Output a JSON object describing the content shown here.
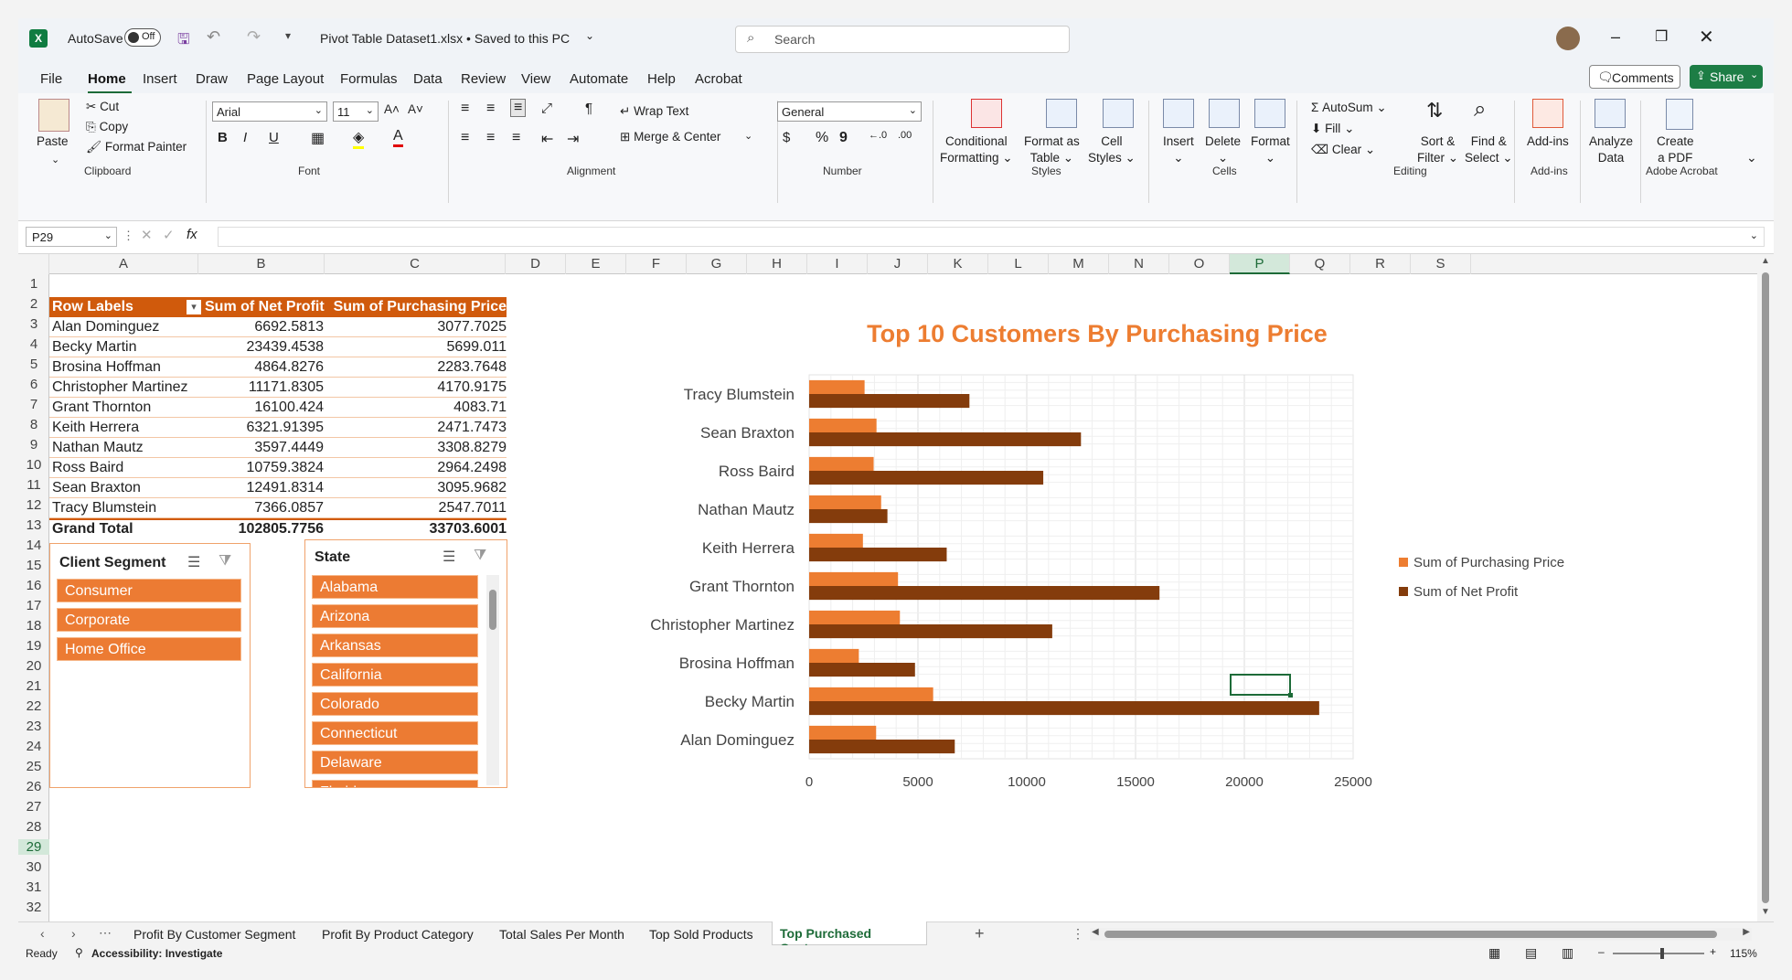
{
  "window": {
    "autosave_label": "AutoSave",
    "autosave_state": "Off",
    "file_title": "Pivot Table Dataset1.xlsx • Saved to this PC",
    "search_placeholder": "Search"
  },
  "menu": {
    "tabs": [
      "File",
      "Home",
      "Insert",
      "Draw",
      "Page Layout",
      "Formulas",
      "Data",
      "Review",
      "View",
      "Automate",
      "Help",
      "Acrobat"
    ],
    "active": "Home",
    "comments": "Comments",
    "share": "Share"
  },
  "ribbon": {
    "clipboard": {
      "paste": "Paste",
      "cut": "Cut",
      "copy": "Copy",
      "format_painter": "Format Painter",
      "label": "Clipboard"
    },
    "font": {
      "name": "Arial",
      "size": "11",
      "bold": "B",
      "italic": "I",
      "underline": "U",
      "label": "Font"
    },
    "alignment": {
      "wrap": "Wrap Text",
      "merge": "Merge & Center",
      "label": "Alignment"
    },
    "number": {
      "format": "General",
      "currency": "$",
      "percent": "%",
      "comma": "9",
      "label": "Number"
    },
    "styles": {
      "conditional": "Conditional",
      "conditional2": "Formatting",
      "format_as": "Format as",
      "format_as2": "Table",
      "cell": "Cell",
      "cell2": "Styles",
      "label": "Styles"
    },
    "cells": {
      "insert": "Insert",
      "delete": "Delete",
      "format": "Format",
      "label": "Cells"
    },
    "editing": {
      "autosum": "AutoSum",
      "fill": "Fill",
      "clear": "Clear",
      "sort": "Sort &",
      "sort2": "Filter",
      "find": "Find &",
      "find2": "Select",
      "label": "Editing"
    },
    "addins": {
      "addins": "Add-ins",
      "label": "Add-ins"
    },
    "analyze": {
      "analyze": "Analyze",
      "analyze2": "Data"
    },
    "acrobat": {
      "create": "Create",
      "create2": "a PDF",
      "label": "Adobe Acrobat"
    }
  },
  "formula_bar": {
    "name_box": "P29",
    "fx": "fx",
    "value": ""
  },
  "columns": [
    "A",
    "B",
    "C",
    "D",
    "E",
    "F",
    "G",
    "H",
    "I",
    "J",
    "K",
    "L",
    "M",
    "N",
    "O",
    "P",
    "Q",
    "R",
    "S"
  ],
  "rows": [
    "1",
    "2",
    "3",
    "4",
    "5",
    "6",
    "7",
    "8",
    "9",
    "10",
    "11",
    "12",
    "13",
    "14",
    "15",
    "16",
    "17",
    "18",
    "19",
    "20",
    "21",
    "22",
    "23",
    "24",
    "25",
    "26",
    "27",
    "28",
    "29",
    "30",
    "31",
    "32"
  ],
  "pivot": {
    "headers": [
      "Row Labels",
      "Sum of Net Profit",
      "Sum of Purchasing Price"
    ],
    "rows": [
      [
        "Alan Dominguez",
        "6692.5813",
        "3077.7025"
      ],
      [
        "Becky Martin",
        "23439.4538",
        "5699.011"
      ],
      [
        "Brosina Hoffman",
        "4864.8276",
        "2283.7648"
      ],
      [
        "Christopher Martinez",
        "11171.8305",
        "4170.9175"
      ],
      [
        "Grant Thornton",
        "16100.424",
        "4083.71"
      ],
      [
        "Keith Herrera",
        "6321.91395",
        "2471.7473"
      ],
      [
        "Nathan Mautz",
        "3597.4449",
        "3308.8279"
      ],
      [
        "Ross Baird",
        "10759.3824",
        "2964.2498"
      ],
      [
        "Sean Braxton",
        "12491.8314",
        "3095.9682"
      ],
      [
        "Tracy Blumstein",
        "7366.0857",
        "2547.7011"
      ]
    ],
    "total": [
      "Grand Total",
      "102805.7756",
      "33703.6001"
    ]
  },
  "slicer_segment": {
    "title": "Client Segment",
    "items": [
      "Consumer",
      "Corporate",
      "Home Office"
    ]
  },
  "slicer_state": {
    "title": "State",
    "items": [
      "Alabama",
      "Arizona",
      "Arkansas",
      "California",
      "Colorado",
      "Connecticut",
      "Delaware",
      "Florida"
    ]
  },
  "chart_data": {
    "type": "bar",
    "orientation": "horizontal",
    "title": "Top 10 Customers By Purchasing Price",
    "categories": [
      "Alan Dominguez",
      "Becky Martin",
      "Brosina Hoffman",
      "Christopher Martinez",
      "Grant Thornton",
      "Keith Herrera",
      "Nathan Mautz",
      "Ross Baird",
      "Sean Braxton",
      "Tracy Blumstein"
    ],
    "series": [
      {
        "name": "Sum of Purchasing Price",
        "color": "#ED7D31",
        "values": [
          3077.7025,
          5699.011,
          2283.7648,
          4170.9175,
          4083.71,
          2471.7473,
          3308.8279,
          2964.2498,
          3095.9682,
          2547.7011
        ]
      },
      {
        "name": "Sum of Net Profit",
        "color": "#843C0C",
        "values": [
          6692.5813,
          23439.4538,
          4864.8276,
          11171.8305,
          16100.424,
          6321.91395,
          3597.4449,
          10759.3824,
          12491.8314,
          7366.0857
        ]
      }
    ],
    "xlim": [
      0,
      25000
    ],
    "xticks": [
      "0",
      "5000",
      "10000",
      "15000",
      "20000",
      "25000"
    ],
    "legend_position": "right",
    "grid": true
  },
  "sheets": {
    "tabs": [
      "Profit By Customer Segment",
      "Profit By Product Category",
      "Total Sales Per Month",
      "Top Sold Products",
      "Top Purchased Customers"
    ],
    "active": "Top Purchased Customers",
    "add": "+"
  },
  "status": {
    "ready": "Ready",
    "accessibility": "Accessibility: Investigate",
    "zoom": "115%"
  }
}
